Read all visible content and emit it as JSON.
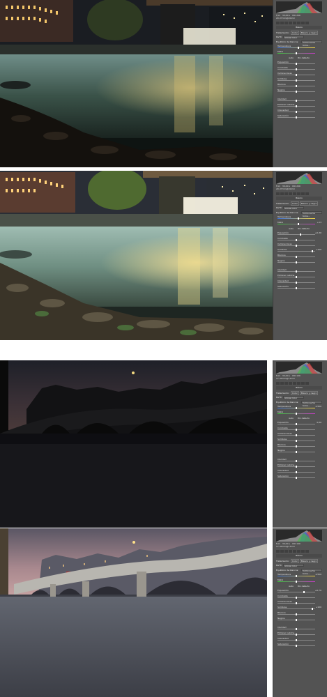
{
  "panels": [
    {
      "readout": {
        "f": "f/11",
        "time": "30,00 s",
        "iso": "ISO 200",
        "lens": "20-37mm@20mm"
      },
      "header": "Básico",
      "treatment_label": "Tratamiento:",
      "color_label": "Color",
      "bw_label": "Blanco y negro",
      "profile_label": "Perfil:",
      "profile_value": "Adobe Color",
      "wb_label": "Equilibrio de blancos:",
      "wb_value": "Como se ha toma...",
      "auto_label": "Auto",
      "default_label": "Por defecto",
      "rows_wb": [
        {
          "label": "Temperatura",
          "value": "",
          "kind": "temp",
          "pos": 0.55
        },
        {
          "label": "Matiz",
          "value": "",
          "kind": "tint",
          "pos": 0.5
        }
      ],
      "rows_tone": [
        {
          "label": "Exposición",
          "value": "",
          "pos": 0.5
        },
        {
          "label": "Contraste",
          "value": "",
          "pos": 0.5
        },
        {
          "label": "Iluminaciones",
          "value": "",
          "pos": 0.5
        },
        {
          "label": "Sombras",
          "value": "",
          "pos": 0.5
        },
        {
          "label": "Blancos",
          "value": "",
          "pos": 0.5
        },
        {
          "label": "Negros",
          "value": "",
          "pos": 0.5
        }
      ],
      "rows_presence": [
        {
          "label": "Claridad",
          "value": "",
          "pos": 0.5
        },
        {
          "label": "Eliminar neblina",
          "value": "",
          "pos": 0.5
        },
        {
          "label": "Intensidad",
          "value": "",
          "pos": 0.5
        },
        {
          "label": "Saturación",
          "value": "",
          "pos": 0.5
        }
      ]
    },
    {
      "readout": {
        "f": "f/11",
        "time": "30,00 s",
        "iso": "ISO 200",
        "lens": "20-37mm@20mm"
      },
      "header": "Básico",
      "treatment_label": "Tratamiento:",
      "color_label": "Color",
      "bw_label": "Blanco y negro",
      "profile_label": "Perfil:",
      "profile_value": "Adobe Color",
      "wb_label": "Equilibrio de blancos:",
      "wb_value": "Como se ha toma...",
      "auto_label": "Auto",
      "default_label": "Por defecto",
      "rows_wb": [
        {
          "label": "Temperatura",
          "value": "",
          "kind": "temp",
          "pos": 0.55
        },
        {
          "label": "Matiz",
          "value": "+13",
          "kind": "tint",
          "pos": 0.55
        }
      ],
      "rows_tone": [
        {
          "label": "Exposición",
          "value": "+0,30",
          "pos": 0.62
        },
        {
          "label": "Contraste",
          "value": "",
          "pos": 0.5
        },
        {
          "label": "Iluminaciones",
          "value": "",
          "pos": 0.5
        },
        {
          "label": "Sombras",
          "value": "+100",
          "pos": 0.95
        },
        {
          "label": "Blancos",
          "value": "",
          "pos": 0.5
        },
        {
          "label": "Negros",
          "value": "",
          "pos": 0.5
        }
      ],
      "rows_presence": [
        {
          "label": "Claridad",
          "value": "",
          "pos": 0.5
        },
        {
          "label": "Eliminar neblina",
          "value": "",
          "pos": 0.5
        },
        {
          "label": "Intensidad",
          "value": "",
          "pos": 0.5
        },
        {
          "label": "Saturación",
          "value": "",
          "pos": 0.5
        }
      ]
    },
    {
      "readout": {
        "f": "f/11",
        "time": "30,00 s",
        "iso": "ISO 100",
        "lens": "17-40mm@17mm"
      },
      "header": "Básico",
      "treatment_label": "Tratamiento:",
      "color_label": "Color",
      "bw_label": "Blanco y negro",
      "profile_label": "Perfil:",
      "profile_value": "Adobe Color",
      "wb_label": "Equilibrio de blancos:",
      "wb_value": "Como se ha toma...",
      "auto_label": "Auto",
      "default_label": "Por defecto",
      "rows_wb": [
        {
          "label": "Temperatura",
          "value": "4.550",
          "kind": "temp",
          "pos": 0.5
        },
        {
          "label": "Matiz",
          "value": "",
          "kind": "tint",
          "pos": 0.5
        }
      ],
      "rows_tone": [
        {
          "label": "Exposición",
          "value": "0,00",
          "pos": 0.5
        },
        {
          "label": "Contraste",
          "value": "",
          "pos": 0.5
        },
        {
          "label": "Iluminaciones",
          "value": "",
          "pos": 0.5
        },
        {
          "label": "Sombras",
          "value": "",
          "pos": 0.5
        },
        {
          "label": "Blancos",
          "value": "",
          "pos": 0.5
        },
        {
          "label": "Negros",
          "value": "",
          "pos": 0.5
        }
      ],
      "rows_presence": [
        {
          "label": "Claridad",
          "value": "",
          "pos": 0.5
        },
        {
          "label": "Eliminar neblina",
          "value": "",
          "pos": 0.5
        },
        {
          "label": "Intensidad",
          "value": "",
          "pos": 0.5
        },
        {
          "label": "Saturación",
          "value": "",
          "pos": 0.5
        }
      ]
    },
    {
      "readout": {
        "f": "f/11",
        "time": "30,00 s",
        "iso": "ISO 100",
        "lens": "17-40mm@17mm"
      },
      "header": "Básico",
      "treatment_label": "Tratamiento:",
      "color_label": "Color",
      "bw_label": "Blanco y negro",
      "profile_label": "Perfil:",
      "profile_value": "Adobe Color",
      "wb_label": "Equilibrio de blancos:",
      "wb_value": "Como se ha toma...",
      "auto_label": "Auto",
      "default_label": "Por defecto",
      "rows_wb": [
        {
          "label": "Temperatura",
          "value": "4.550",
          "kind": "temp",
          "pos": 0.5
        },
        {
          "label": "Matiz",
          "value": "",
          "kind": "tint",
          "pos": 0.5
        }
      ],
      "rows_tone": [
        {
          "label": "Exposición",
          "value": "+0,70",
          "pos": 0.72
        },
        {
          "label": "Contraste",
          "value": "",
          "pos": 0.5
        },
        {
          "label": "Iluminaciones",
          "value": "",
          "pos": 0.5
        },
        {
          "label": "Sombras",
          "value": "+100",
          "pos": 0.95
        },
        {
          "label": "Blancos",
          "value": "",
          "pos": 0.5
        },
        {
          "label": "Negros",
          "value": "",
          "pos": 0.5
        }
      ],
      "rows_presence": [
        {
          "label": "Claridad",
          "value": "",
          "pos": 0.5
        },
        {
          "label": "Eliminar neblina",
          "value": "",
          "pos": 0.5
        },
        {
          "label": "Intensidad",
          "value": "",
          "pos": 0.5
        },
        {
          "label": "Saturación",
          "value": "",
          "pos": 0.5
        }
      ]
    }
  ]
}
